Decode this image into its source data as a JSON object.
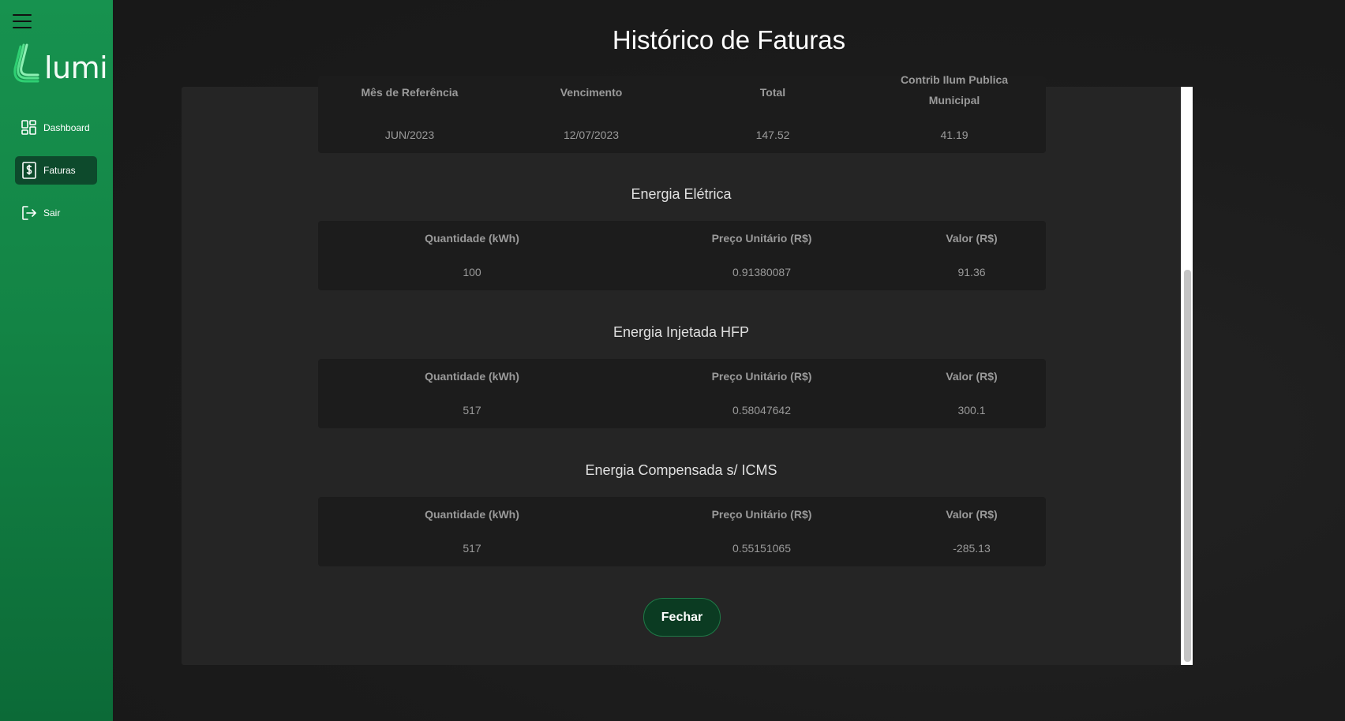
{
  "app": {
    "logo_text": "lumi"
  },
  "sidebar": {
    "items": [
      {
        "label": "Dashboard",
        "icon": "dashboard-icon"
      },
      {
        "label": "Faturas",
        "icon": "invoice-dollar-icon",
        "active": true
      },
      {
        "label": "Sair",
        "icon": "logout-icon"
      }
    ]
  },
  "page": {
    "title": "Histórico de Faturas"
  },
  "summary": {
    "headers": [
      "Mês de Referência",
      "Vencimento",
      "Total",
      "Contrib Ilum Publica",
      "Municipal"
    ],
    "values": [
      "JUN/2023",
      "12/07/2023",
      "147.52",
      "41.19"
    ]
  },
  "sections": [
    {
      "title": "Energia Elétrica",
      "headers": [
        "Quantidade (kWh)",
        "Preço Unitário (R$)",
        "Valor (R$)"
      ],
      "values": [
        "100",
        "0.91380087",
        "91.36"
      ]
    },
    {
      "title": "Energia Injetada HFP",
      "headers": [
        "Quantidade (kWh)",
        "Preço Unitário (R$)",
        "Valor (R$)"
      ],
      "values": [
        "517",
        "0.58047642",
        "300.1"
      ]
    },
    {
      "title": "Energia Compensada s/ ICMS",
      "headers": [
        "Quantidade (kWh)",
        "Preço Unitário (R$)",
        "Valor (R$)"
      ],
      "values": [
        "517",
        "0.55151065",
        "-285.13"
      ]
    }
  ],
  "modal": {
    "close_label": "Fechar"
  },
  "colors": {
    "sidebar_green": "#17924f",
    "active_nav": "#0d4a2c",
    "button_bg": "#0b3b22",
    "background": "#171717"
  }
}
